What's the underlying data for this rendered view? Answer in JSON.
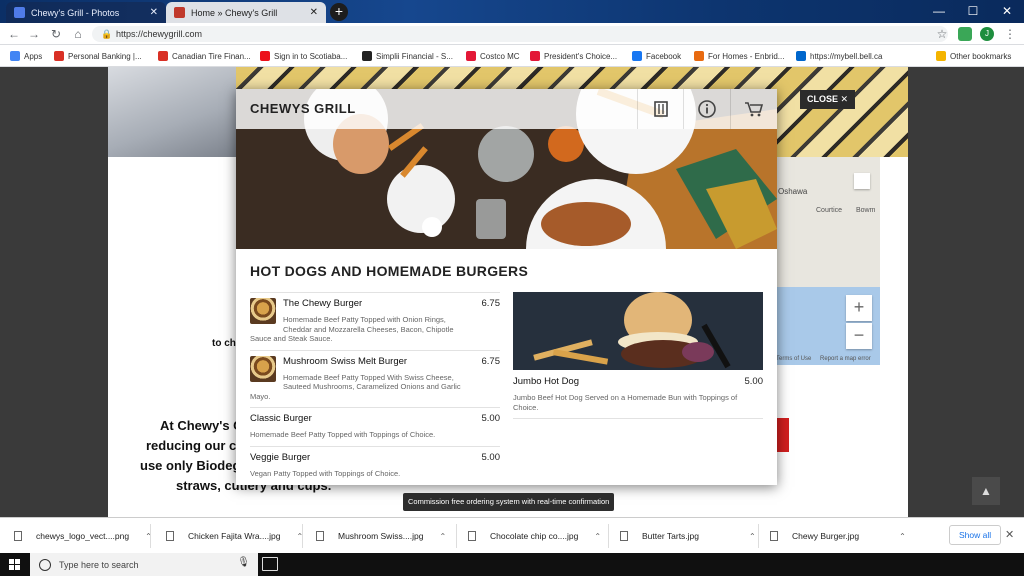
{
  "browser": {
    "tabs": [
      {
        "label": "Chewy's Grill - Photos",
        "active": false
      },
      {
        "label": "Home » Chewy's Grill",
        "active": true
      }
    ],
    "new_tab": "+",
    "window_controls": {
      "minimize": "—",
      "maximize": "☐",
      "close": "✕"
    },
    "url": "https://chewygrill.com",
    "bookmarks": [
      {
        "label": "Apps",
        "color": "#4285f4"
      },
      {
        "label": "Personal Banking |...",
        "color": "#d93025"
      },
      {
        "label": "Canadian Tire Finan...",
        "color": "#d93025"
      },
      {
        "label": "Sign in to Scotiaba...",
        "color": "#ec111a"
      },
      {
        "label": "Simplii Financial - S...",
        "color": "#222222"
      },
      {
        "label": "Costco MC",
        "color": "#e31837"
      },
      {
        "label": "President's Choice...",
        "color": "#e31837"
      },
      {
        "label": "Facebook",
        "color": "#1877f2"
      },
      {
        "label": "For Homes - Enbrid...",
        "color": "#e86a10"
      },
      {
        "label": "https://mybell.bell.ca",
        "color": "#0066cc"
      },
      {
        "label": "Other bookmarks",
        "color": "#f4b400"
      }
    ],
    "profile_initial": "J"
  },
  "modal": {
    "brand": "CHEWYS GRILL",
    "close_label": "CLOSE ✕",
    "section_title": "HOT DOGS AND HOMEMADE BURGERS",
    "items_left": [
      {
        "name": "The Chewy Burger",
        "price": "6.75",
        "desc_first": "Homemade Beef Patty Topped with Onion Rings,",
        "desc_rest": [
          "Cheddar and Mozzarella Cheeses, Bacon, Chipotle"
        ],
        "desc_tail": "Sauce and Steak Sauce.",
        "thumb": true
      },
      {
        "name": "Mushroom Swiss Melt Burger",
        "price": "6.75",
        "desc_first": "Homemade Beef Patty Topped With Swiss Cheese,",
        "desc_rest": [
          "Sauteed Mushrooms, Caramelized Onions and Garlic"
        ],
        "desc_tail": "Mayo.",
        "thumb": true
      },
      {
        "name": "Classic Burger",
        "price": "5.00",
        "desc": "Homemade Beef Patty Topped with Toppings of Choice.",
        "thumb": false
      },
      {
        "name": "Veggie Burger",
        "price": "5.00",
        "desc": "Vegan Patty Topped with Toppings of Choice.",
        "thumb": false
      }
    ],
    "feature_item": {
      "name": "Jumbo Hot Dog",
      "price": "5.00",
      "desc": "Jumbo Beef Hot Dog Served on a Homemade Bun with Toppings of Choice."
    }
  },
  "background_page": {
    "side_text_1": "to ch",
    "side_text_2": "At Chewy's C",
    "side_text_3": "reducing our c",
    "side_text_4": "use only Biodeg",
    "side_text_5": "straws, cutlery and cups.",
    "map_labels": {
      "city": "Oshawa",
      "area1": "Courtice",
      "area2": "Bowm",
      "terms": "Terms of Use",
      "report": "Report a map error",
      "zoom_in": "+",
      "zoom_out": "−"
    }
  },
  "tooltip": "Commission free ordering system with real-time confirmation",
  "downloads": {
    "files": [
      "chewys_logo_vect....png",
      "Chicken Fajita Wra....jpg",
      "Mushroom Swiss....jpg",
      "Chocolate chip co....jpg",
      "Butter Tarts.jpg",
      "Chewy Burger.jpg"
    ],
    "show_all": "Show all",
    "close": "✕"
  },
  "taskbar": {
    "search_placeholder": "Type here to search"
  }
}
